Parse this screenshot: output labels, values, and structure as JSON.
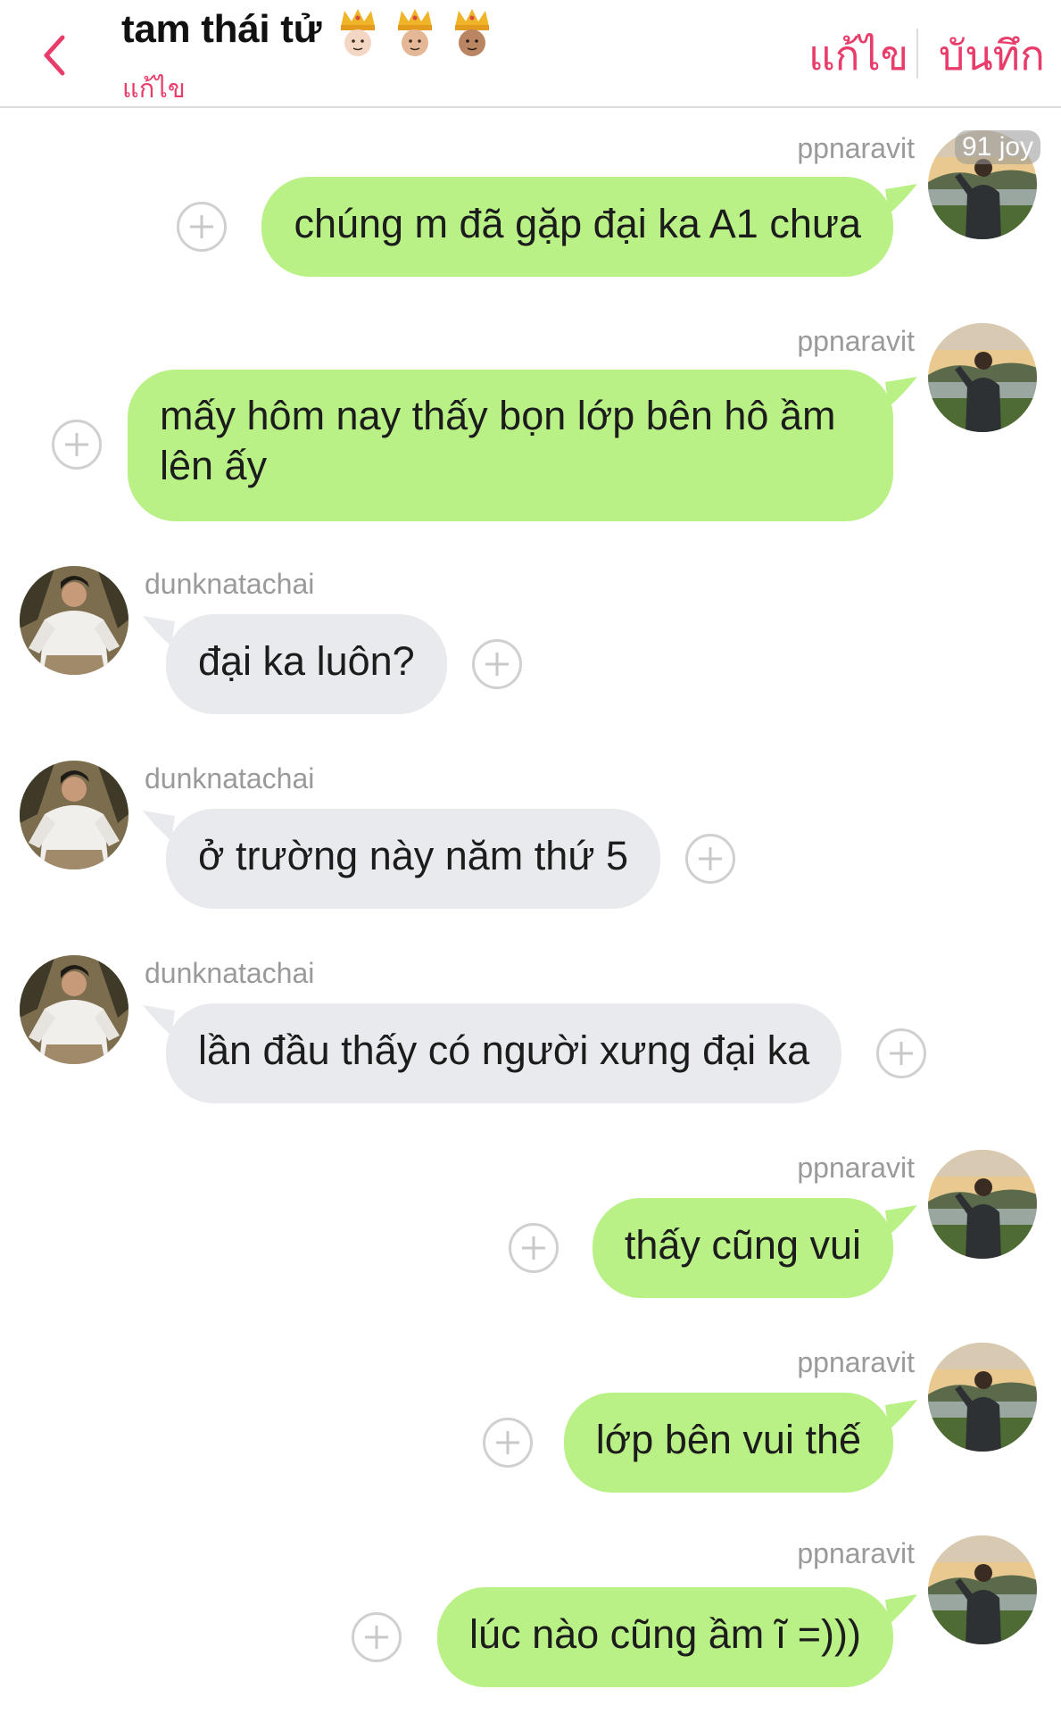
{
  "header": {
    "title": "tam thái tử",
    "crowns": [
      "crown-light",
      "crown-medium-light",
      "crown-medium"
    ],
    "subtitle_edit": "แก้ไข",
    "edit_label": "แก้ไข",
    "save_label": "บันทึก"
  },
  "badge": "91 joy",
  "colors": {
    "accent": "#e83d6a",
    "outgoing_bubble": "#b9f187",
    "incoming_bubble": "#e8eaed"
  },
  "messages": [
    {
      "sender": "ppnaravit",
      "text": "chúng m đã gặp đại ka A1 chưa",
      "direction": "out"
    },
    {
      "sender": "ppnaravit",
      "text": "mấy hôm nay thấy bọn lớp bên hô ầm lên ấy",
      "direction": "out"
    },
    {
      "sender": "dunknatachai",
      "text": "đại ka luôn?",
      "direction": "in"
    },
    {
      "sender": "dunknatachai",
      "text": "ở trường này năm thứ 5",
      "direction": "in"
    },
    {
      "sender": "dunknatachai",
      "text": "lần đầu thấy có người xưng đại ka",
      "direction": "in"
    },
    {
      "sender": "ppnaravit",
      "text": "thấy cũng vui",
      "direction": "out"
    },
    {
      "sender": "ppnaravit",
      "text": "lớp bên vui thế",
      "direction": "out"
    },
    {
      "sender": "ppnaravit",
      "text": "lúc nào cũng ầm ĩ =)))",
      "direction": "out"
    }
  ]
}
